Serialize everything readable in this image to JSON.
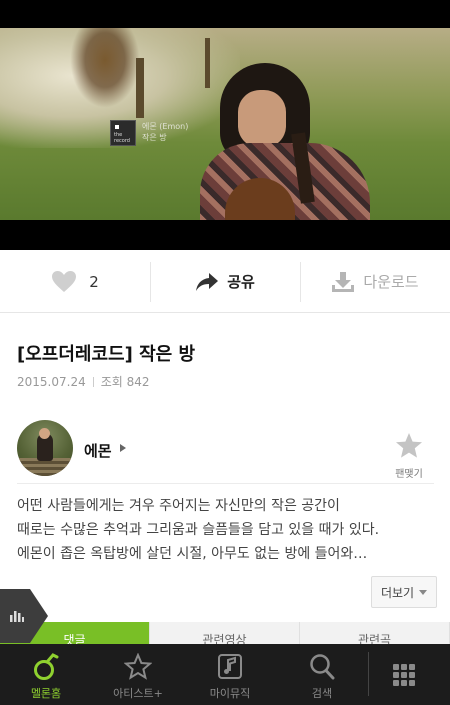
{
  "video": {
    "overlay_artist": "에몬 (Emon)",
    "overlay_title": "작은 방",
    "badge_text": "the record"
  },
  "actions": {
    "like_count": "2",
    "share_label": "공유",
    "download_label": "다운로드"
  },
  "video_info": {
    "title": "[오프더레코드] 작은 방",
    "date": "2015.07.24",
    "views": "조회 842"
  },
  "artist": {
    "name": "에몬",
    "fan_label": "팬맺기"
  },
  "description": {
    "lines": [
      "어떤 사람들에게는 겨우 주어지는 자신만의 작은 공간이",
      "때로는 수많은 추억과 그리움과 슬픔들을 담고 있을 때가 있다.",
      "에몬이 좁은 옥탑방에 살던 시절, 아무도 없는 방에 들어와…"
    ],
    "more_label": "더보기"
  },
  "subtabs": [
    "댓글",
    "관련영상",
    "관련곡"
  ],
  "bottom_nav": [
    {
      "label": "멜론홈",
      "icon": "melon-home-icon",
      "active": true
    },
    {
      "label": "아티스트+",
      "icon": "star-icon",
      "active": false
    },
    {
      "label": "마이뮤직",
      "icon": "music-note-icon",
      "active": false
    },
    {
      "label": "검색",
      "icon": "search-icon",
      "active": false
    }
  ],
  "colors": {
    "accent": "#79bf26",
    "nav_bg": "#1c1c1c",
    "active_nav": "#8fd12f"
  }
}
